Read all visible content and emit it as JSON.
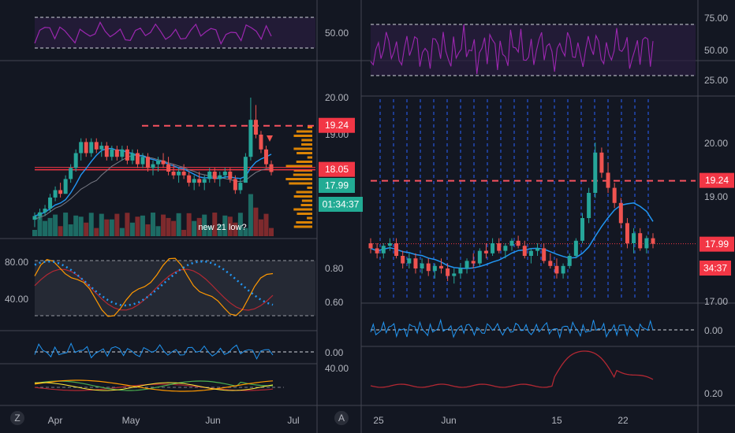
{
  "colors": {
    "bg": "#131722",
    "border": "#434651",
    "grid": "#2a2e39",
    "up": "#26a69a",
    "down": "#ef5350",
    "red_level": "#f23645",
    "dashed_red": "#f7525f",
    "teal_tag": "#22ab94",
    "purple": "#9c27b0",
    "purple_fill": "#2a1e3e",
    "orange": "#ff9800",
    "blue": "#2196f3",
    "green": "#4caf50",
    "dark_red": "#b22833",
    "yellow": "#ffeb3b",
    "text": "#b2b5be"
  },
  "left_chart": {
    "date_labels": [
      "Apr",
      "May",
      "Jun",
      "Jul"
    ],
    "rsi_axis_label": "50.00",
    "price_axis_labels": [
      "20.00",
      "19.00"
    ],
    "price_tags": {
      "dashed_level": "19.24",
      "red_level": "18.05",
      "last_price": "17.99",
      "countdown": "01:34:37"
    },
    "annotation": "new 21 low?",
    "stoch_axis_labels": [
      "0.80",
      "0.60"
    ],
    "stoch_left_labels": [
      "80.00",
      "40.00"
    ],
    "mom_axis_label": "0.00",
    "osc_axis_label": "40.00",
    "badge_letter": "Z"
  },
  "right_chart": {
    "date_labels": [
      "25",
      "Jun",
      "15",
      "22"
    ],
    "rsi_axis_labels": [
      "75.00",
      "50.00",
      "25.00"
    ],
    "price_axis_labels": [
      "20.00",
      "19.00",
      "17.00"
    ],
    "price_tags": {
      "dashed_level": "19.24",
      "last_price": "17.99",
      "countdown": "34:37"
    },
    "mom_axis_label": "0.00",
    "low_axis_label": "0.20",
    "badge_letter": "A"
  },
  "chart_data": [
    {
      "type": "candlestick",
      "title": "",
      "x_ticks": [
        "Apr",
        "May",
        "Jun",
        "Jul"
      ],
      "y_ticks": [
        19.0,
        20.0
      ],
      "levels": {
        "dashed_resistance": 19.24,
        "red_line": 18.05,
        "last": 17.99
      },
      "candles_ohlc": [
        [
          16.7,
          16.9,
          16.5,
          16.8
        ],
        [
          16.8,
          17.0,
          16.7,
          16.9
        ],
        [
          16.9,
          17.1,
          16.8,
          17.0
        ],
        [
          17.0,
          17.4,
          16.9,
          17.3
        ],
        [
          17.3,
          17.6,
          17.2,
          17.5
        ],
        [
          17.5,
          17.7,
          17.3,
          17.4
        ],
        [
          17.4,
          17.9,
          17.4,
          17.8
        ],
        [
          17.8,
          18.2,
          17.7,
          18.1
        ],
        [
          18.1,
          18.6,
          18.0,
          18.5
        ],
        [
          18.5,
          18.9,
          18.3,
          18.8
        ],
        [
          18.8,
          18.9,
          18.4,
          18.5
        ],
        [
          18.5,
          18.9,
          18.4,
          18.8
        ],
        [
          18.8,
          18.9,
          18.5,
          18.6
        ],
        [
          18.6,
          18.8,
          18.4,
          18.7
        ],
        [
          18.7,
          18.8,
          18.3,
          18.4
        ],
        [
          18.4,
          18.7,
          18.3,
          18.6
        ],
        [
          18.6,
          18.7,
          18.3,
          18.4
        ],
        [
          18.4,
          18.7,
          18.3,
          18.6
        ],
        [
          18.6,
          18.7,
          18.2,
          18.3
        ],
        [
          18.3,
          18.6,
          18.2,
          18.5
        ],
        [
          18.5,
          18.6,
          18.1,
          18.2
        ],
        [
          18.2,
          18.5,
          18.1,
          18.4
        ],
        [
          18.4,
          18.5,
          18.0,
          18.1
        ],
        [
          18.1,
          18.3,
          17.9,
          18.2
        ],
        [
          18.2,
          18.4,
          18.0,
          18.3
        ],
        [
          18.3,
          18.5,
          18.1,
          18.2
        ],
        [
          18.2,
          18.4,
          17.9,
          18.0
        ],
        [
          18.0,
          18.2,
          17.8,
          17.9
        ],
        [
          17.9,
          18.1,
          17.7,
          18.0
        ],
        [
          18.0,
          18.2,
          17.8,
          17.9
        ],
        [
          17.9,
          18.0,
          17.6,
          17.7
        ],
        [
          17.7,
          17.9,
          17.5,
          17.8
        ],
        [
          17.8,
          18.0,
          17.6,
          17.7
        ],
        [
          17.7,
          17.9,
          17.5,
          17.8
        ],
        [
          17.8,
          18.1,
          17.7,
          18.0
        ],
        [
          18.0,
          18.1,
          17.7,
          17.8
        ],
        [
          17.8,
          18.0,
          17.6,
          17.9
        ],
        [
          17.9,
          18.1,
          17.8,
          18.0
        ],
        [
          18.0,
          18.1,
          17.7,
          17.8
        ],
        [
          17.8,
          17.9,
          17.4,
          17.5
        ],
        [
          17.5,
          17.8,
          17.4,
          17.7
        ],
        [
          17.7,
          18.5,
          17.7,
          18.4
        ],
        [
          18.4,
          20.0,
          18.3,
          19.4
        ],
        [
          19.4,
          19.8,
          18.9,
          19.0
        ],
        [
          19.0,
          19.1,
          18.5,
          18.6
        ],
        [
          18.6,
          18.7,
          18.1,
          18.2
        ],
        [
          18.2,
          18.3,
          17.9,
          17.99
        ]
      ]
    },
    {
      "type": "candlestick",
      "title": "",
      "x_ticks": [
        "25",
        "Jun",
        "15",
        "22"
      ],
      "y_ticks": [
        17.0,
        19.0,
        20.0
      ],
      "levels": {
        "dashed_resistance": 19.24,
        "last": 17.99
      },
      "candles_ohlc": [
        [
          18.0,
          18.1,
          17.8,
          17.9
        ],
        [
          17.9,
          18.0,
          17.7,
          17.8
        ],
        [
          17.8,
          18.0,
          17.7,
          17.95
        ],
        [
          17.95,
          18.1,
          17.85,
          18.0
        ],
        [
          18.0,
          18.1,
          17.7,
          17.75
        ],
        [
          17.75,
          17.85,
          17.5,
          17.6
        ],
        [
          17.6,
          17.8,
          17.5,
          17.7
        ],
        [
          17.7,
          17.8,
          17.4,
          17.5
        ],
        [
          17.5,
          17.7,
          17.4,
          17.6
        ],
        [
          17.6,
          17.7,
          17.35,
          17.45
        ],
        [
          17.45,
          17.6,
          17.3,
          17.55
        ],
        [
          17.55,
          17.7,
          17.4,
          17.5
        ],
        [
          17.5,
          17.6,
          17.25,
          17.35
        ],
        [
          17.35,
          17.5,
          17.2,
          17.4
        ],
        [
          17.4,
          17.6,
          17.3,
          17.5
        ],
        [
          17.5,
          17.7,
          17.4,
          17.65
        ],
        [
          17.65,
          17.8,
          17.5,
          17.6
        ],
        [
          17.6,
          17.9,
          17.55,
          17.85
        ],
        [
          17.85,
          18.0,
          17.7,
          17.8
        ],
        [
          17.8,
          18.1,
          17.75,
          18.0
        ],
        [
          18.0,
          18.1,
          17.8,
          17.85
        ],
        [
          17.85,
          18.0,
          17.7,
          17.95
        ],
        [
          17.95,
          18.1,
          17.85,
          18.05
        ],
        [
          18.05,
          18.15,
          17.9,
          17.95
        ],
        [
          17.95,
          18.05,
          17.7,
          17.75
        ],
        [
          17.75,
          17.9,
          17.6,
          17.85
        ],
        [
          17.85,
          18.0,
          17.75,
          17.9
        ],
        [
          17.9,
          18.0,
          17.6,
          17.65
        ],
        [
          17.65,
          17.8,
          17.5,
          17.55
        ],
        [
          17.55,
          17.7,
          17.3,
          17.4
        ],
        [
          17.4,
          17.6,
          17.3,
          17.55
        ],
        [
          17.55,
          17.8,
          17.5,
          17.75
        ],
        [
          17.75,
          18.1,
          17.7,
          18.05
        ],
        [
          18.05,
          18.6,
          18.0,
          18.5
        ],
        [
          18.5,
          19.1,
          18.4,
          19.0
        ],
        [
          19.0,
          20.0,
          18.9,
          19.8
        ],
        [
          19.8,
          19.9,
          19.3,
          19.4
        ],
        [
          19.4,
          19.6,
          19.0,
          19.1
        ],
        [
          19.1,
          19.2,
          18.7,
          18.8
        ],
        [
          18.8,
          18.9,
          18.3,
          18.4
        ],
        [
          18.4,
          18.5,
          17.9,
          18.0
        ],
        [
          18.0,
          18.3,
          17.8,
          18.2
        ],
        [
          18.2,
          18.3,
          17.85,
          17.9
        ],
        [
          17.9,
          18.15,
          17.8,
          18.1
        ],
        [
          18.1,
          18.2,
          17.9,
          17.99
        ]
      ]
    }
  ]
}
